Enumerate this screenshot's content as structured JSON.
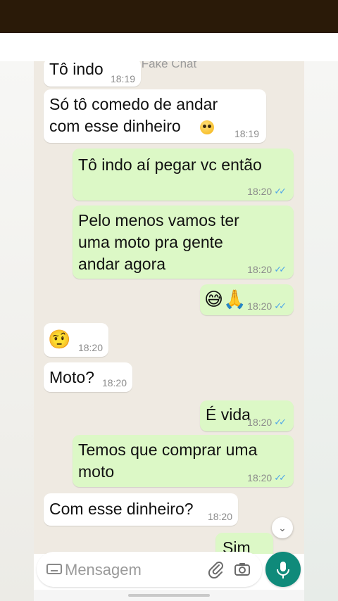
{
  "chat": {
    "header_title": "Fake Chat",
    "messages": [
      {
        "text": "Tô indo",
        "time": "18:19"
      },
      {
        "line1": "Só tô comedo de andar",
        "line2": "com esse dinheiro",
        "time": "18:19"
      },
      {
        "text": "Tô indo aí pegar vc então",
        "time": "18:20"
      },
      {
        "line1": "Pelo menos vamos ter",
        "line2": "uma moto pra gente",
        "line3": "andar agora",
        "time": "18:20"
      },
      {
        "emoji": "😅🙏",
        "time": "18:20"
      },
      {
        "emoji": "🤨",
        "time": "18:20"
      },
      {
        "text": "Moto?",
        "time": "18:20"
      },
      {
        "text": "É vida",
        "time": "18:20"
      },
      {
        "line1": "Temos que comprar uma",
        "line2": "moto",
        "time": "18:20"
      },
      {
        "text": "Com esse dinheiro?",
        "time": "18:20"
      },
      {
        "text": "Sim"
      }
    ]
  },
  "composer": {
    "placeholder": "Mensagem"
  },
  "icons": {
    "keyboard": "keyboard-icon",
    "attach": "paperclip-icon",
    "camera": "camera-icon",
    "mic": "microphone-icon",
    "scroll": "chevron-double-down-icon",
    "read_receipt": "double-check-icon",
    "pleading_face": "pleading-face-emoji"
  },
  "colors": {
    "incoming_bubble": "#ffffff",
    "outgoing_bubble": "#dcf8c6",
    "chat_background": "#efeae2",
    "read_ticks": "#4fa6e8",
    "mic_button": "#0f8a7a",
    "top_bar": "#2a1a08"
  }
}
